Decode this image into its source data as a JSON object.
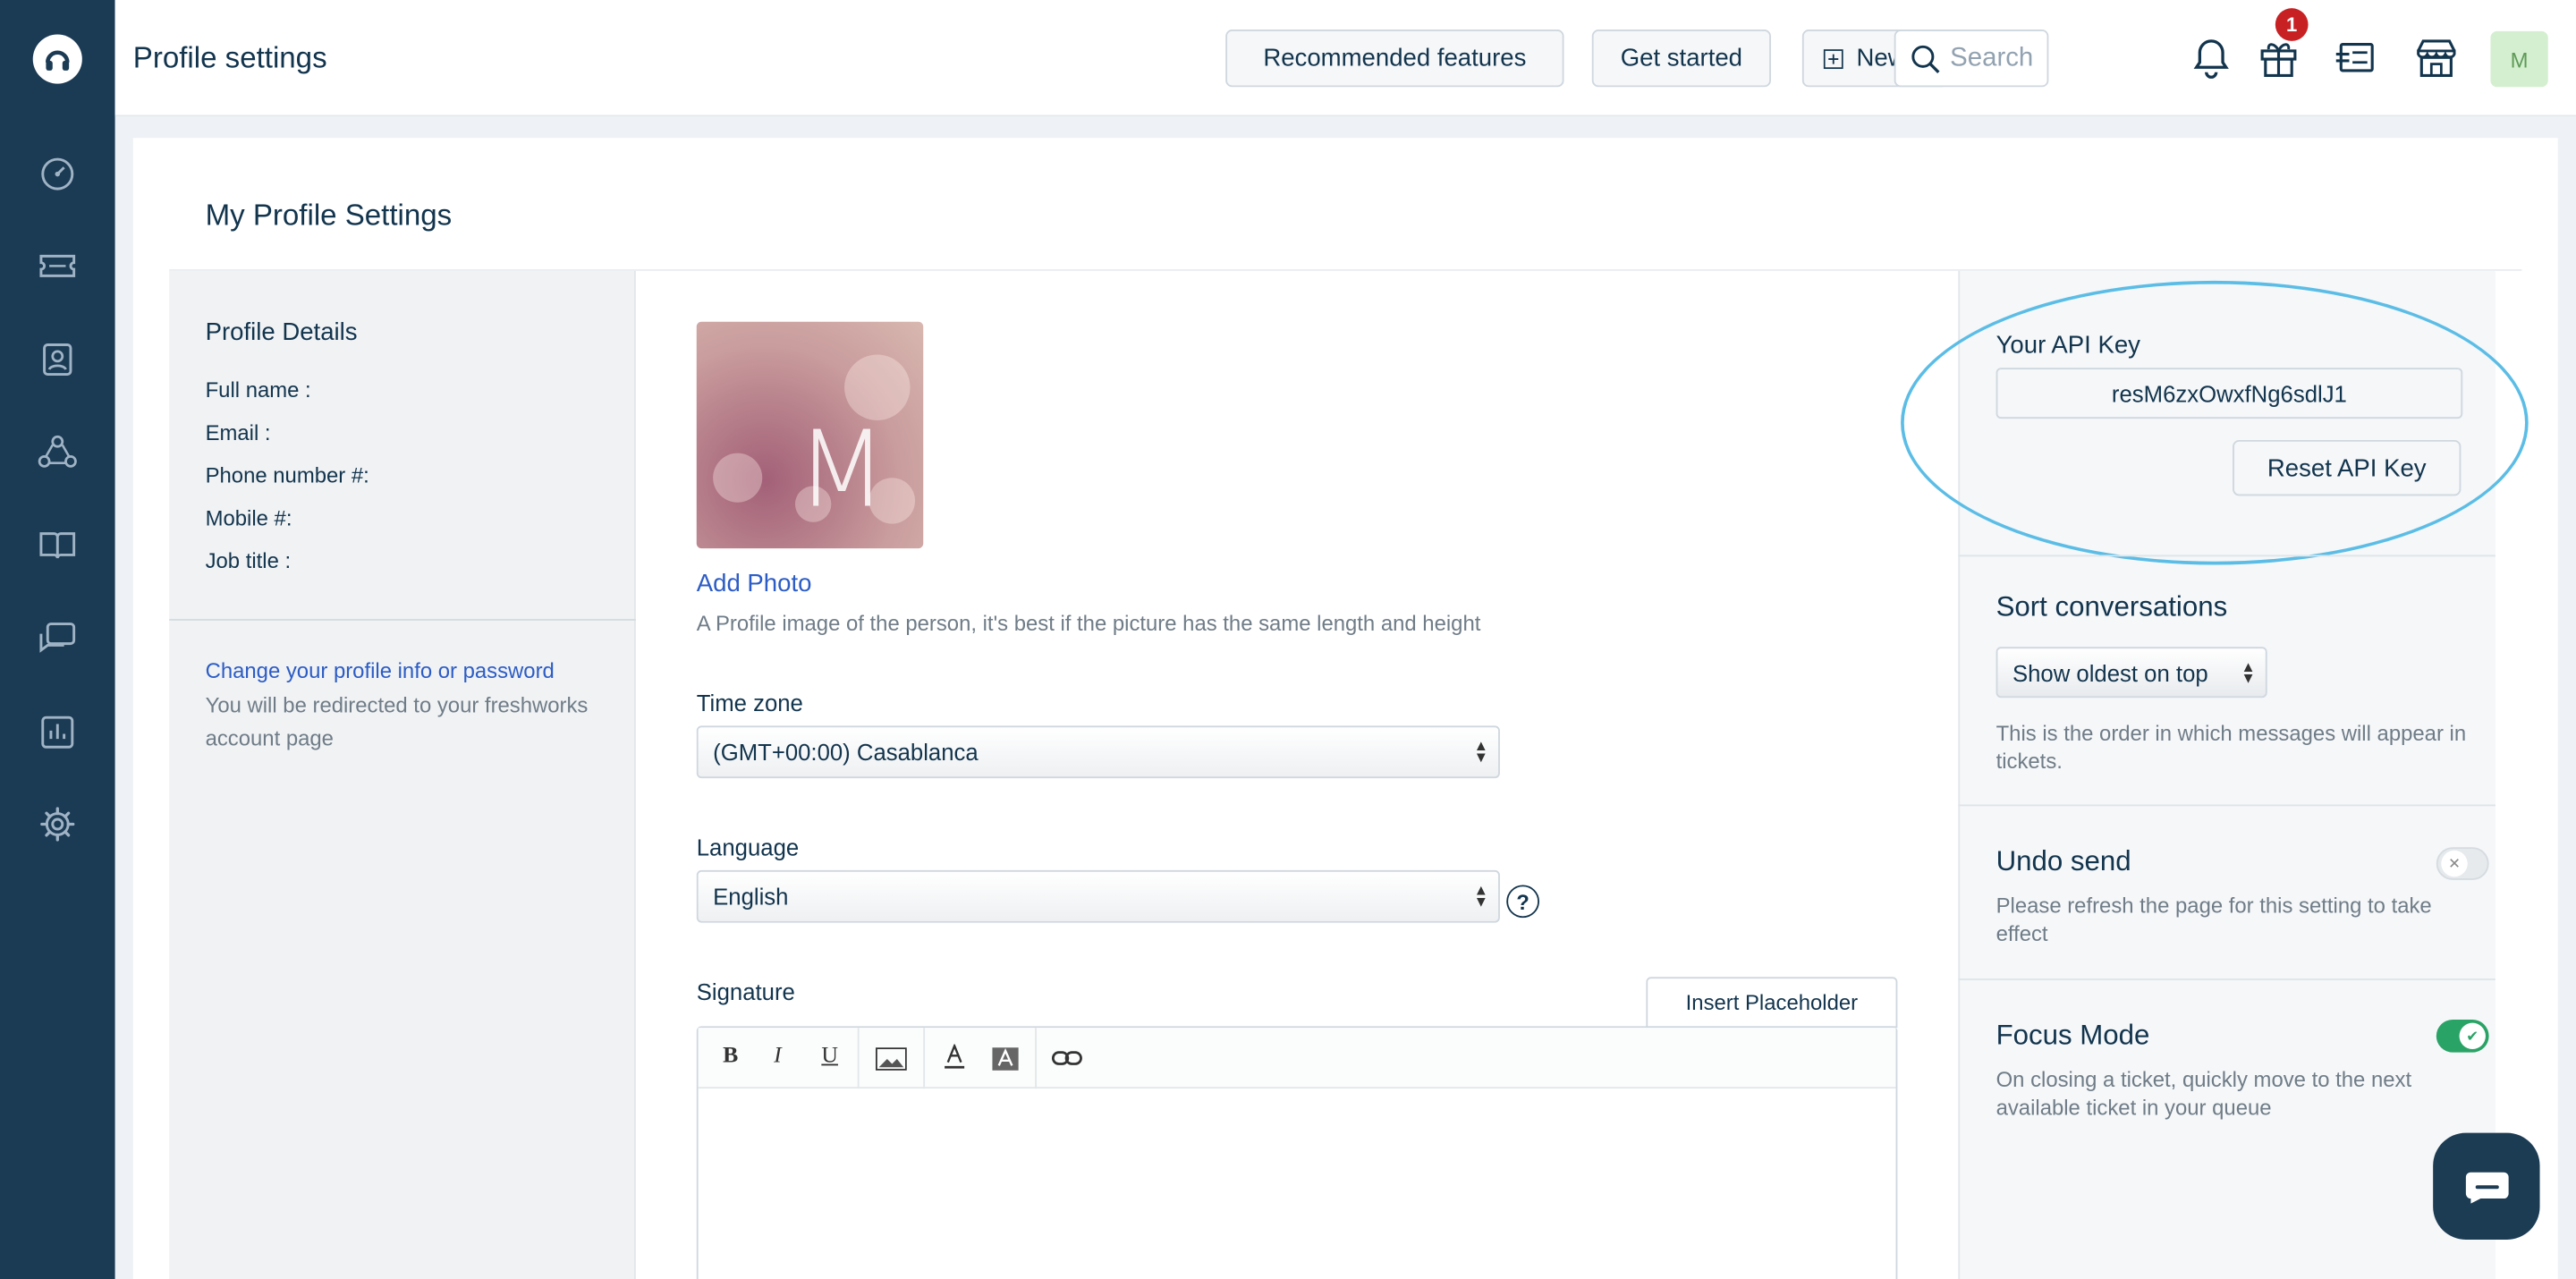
{
  "topbar": {
    "title": "Profile settings",
    "recommended_label": "Recommended features",
    "get_started_label": "Get started",
    "new_label": "New",
    "search_placeholder": "Search",
    "notification_count": "1",
    "avatar_initial": "M"
  },
  "sidebar": {
    "items": [
      "dashboard-icon",
      "tickets-icon",
      "contacts-icon",
      "groups-icon",
      "solutions-icon",
      "forums-icon",
      "reports-icon",
      "admin-icon"
    ]
  },
  "main": {
    "section_title": "My Profile Settings",
    "profile_details": {
      "heading": "Profile Details",
      "fields": [
        "Full name :",
        "Email :",
        "Phone number #:",
        "Mobile #:",
        "Job title :"
      ],
      "change_link": "Change your profile info or password",
      "change_note": "You will be redirected to your freshworks account page"
    },
    "photo": {
      "letter": "M",
      "add_label": "Add Photo",
      "hint": "A Profile image of the person, it's best if the picture has the same length and height"
    },
    "timezone": {
      "label": "Time zone",
      "value": "(GMT+00:00) Casablanca"
    },
    "language": {
      "label": "Language",
      "value": "English"
    },
    "signature": {
      "label": "Signature",
      "insert_placeholder": "Insert Placeholder",
      "toolbar": [
        "B",
        "I",
        "U"
      ]
    }
  },
  "right": {
    "api_key_label": "Your API Key",
    "api_key_value": "resM6zxOwxfNg6sdlJ1",
    "reset_label": "Reset API Key",
    "sort": {
      "heading": "Sort conversations",
      "value": "Show oldest on top",
      "note": "This is the order in which messages will appear in tickets."
    },
    "undo_send": {
      "heading": "Undo send",
      "note": "Please refresh the page for this setting to take effect",
      "enabled": false
    },
    "focus_mode": {
      "heading": "Focus Mode",
      "note": "On closing a ticket, quickly move to the next available ticket in your queue",
      "enabled": true
    }
  },
  "colors": {
    "sidebar": "#1b3a54",
    "link": "#2c5cc5",
    "highlight_ellipse": "#5bbde6",
    "toggle_on": "#2aa366",
    "badge": "#c82124"
  }
}
